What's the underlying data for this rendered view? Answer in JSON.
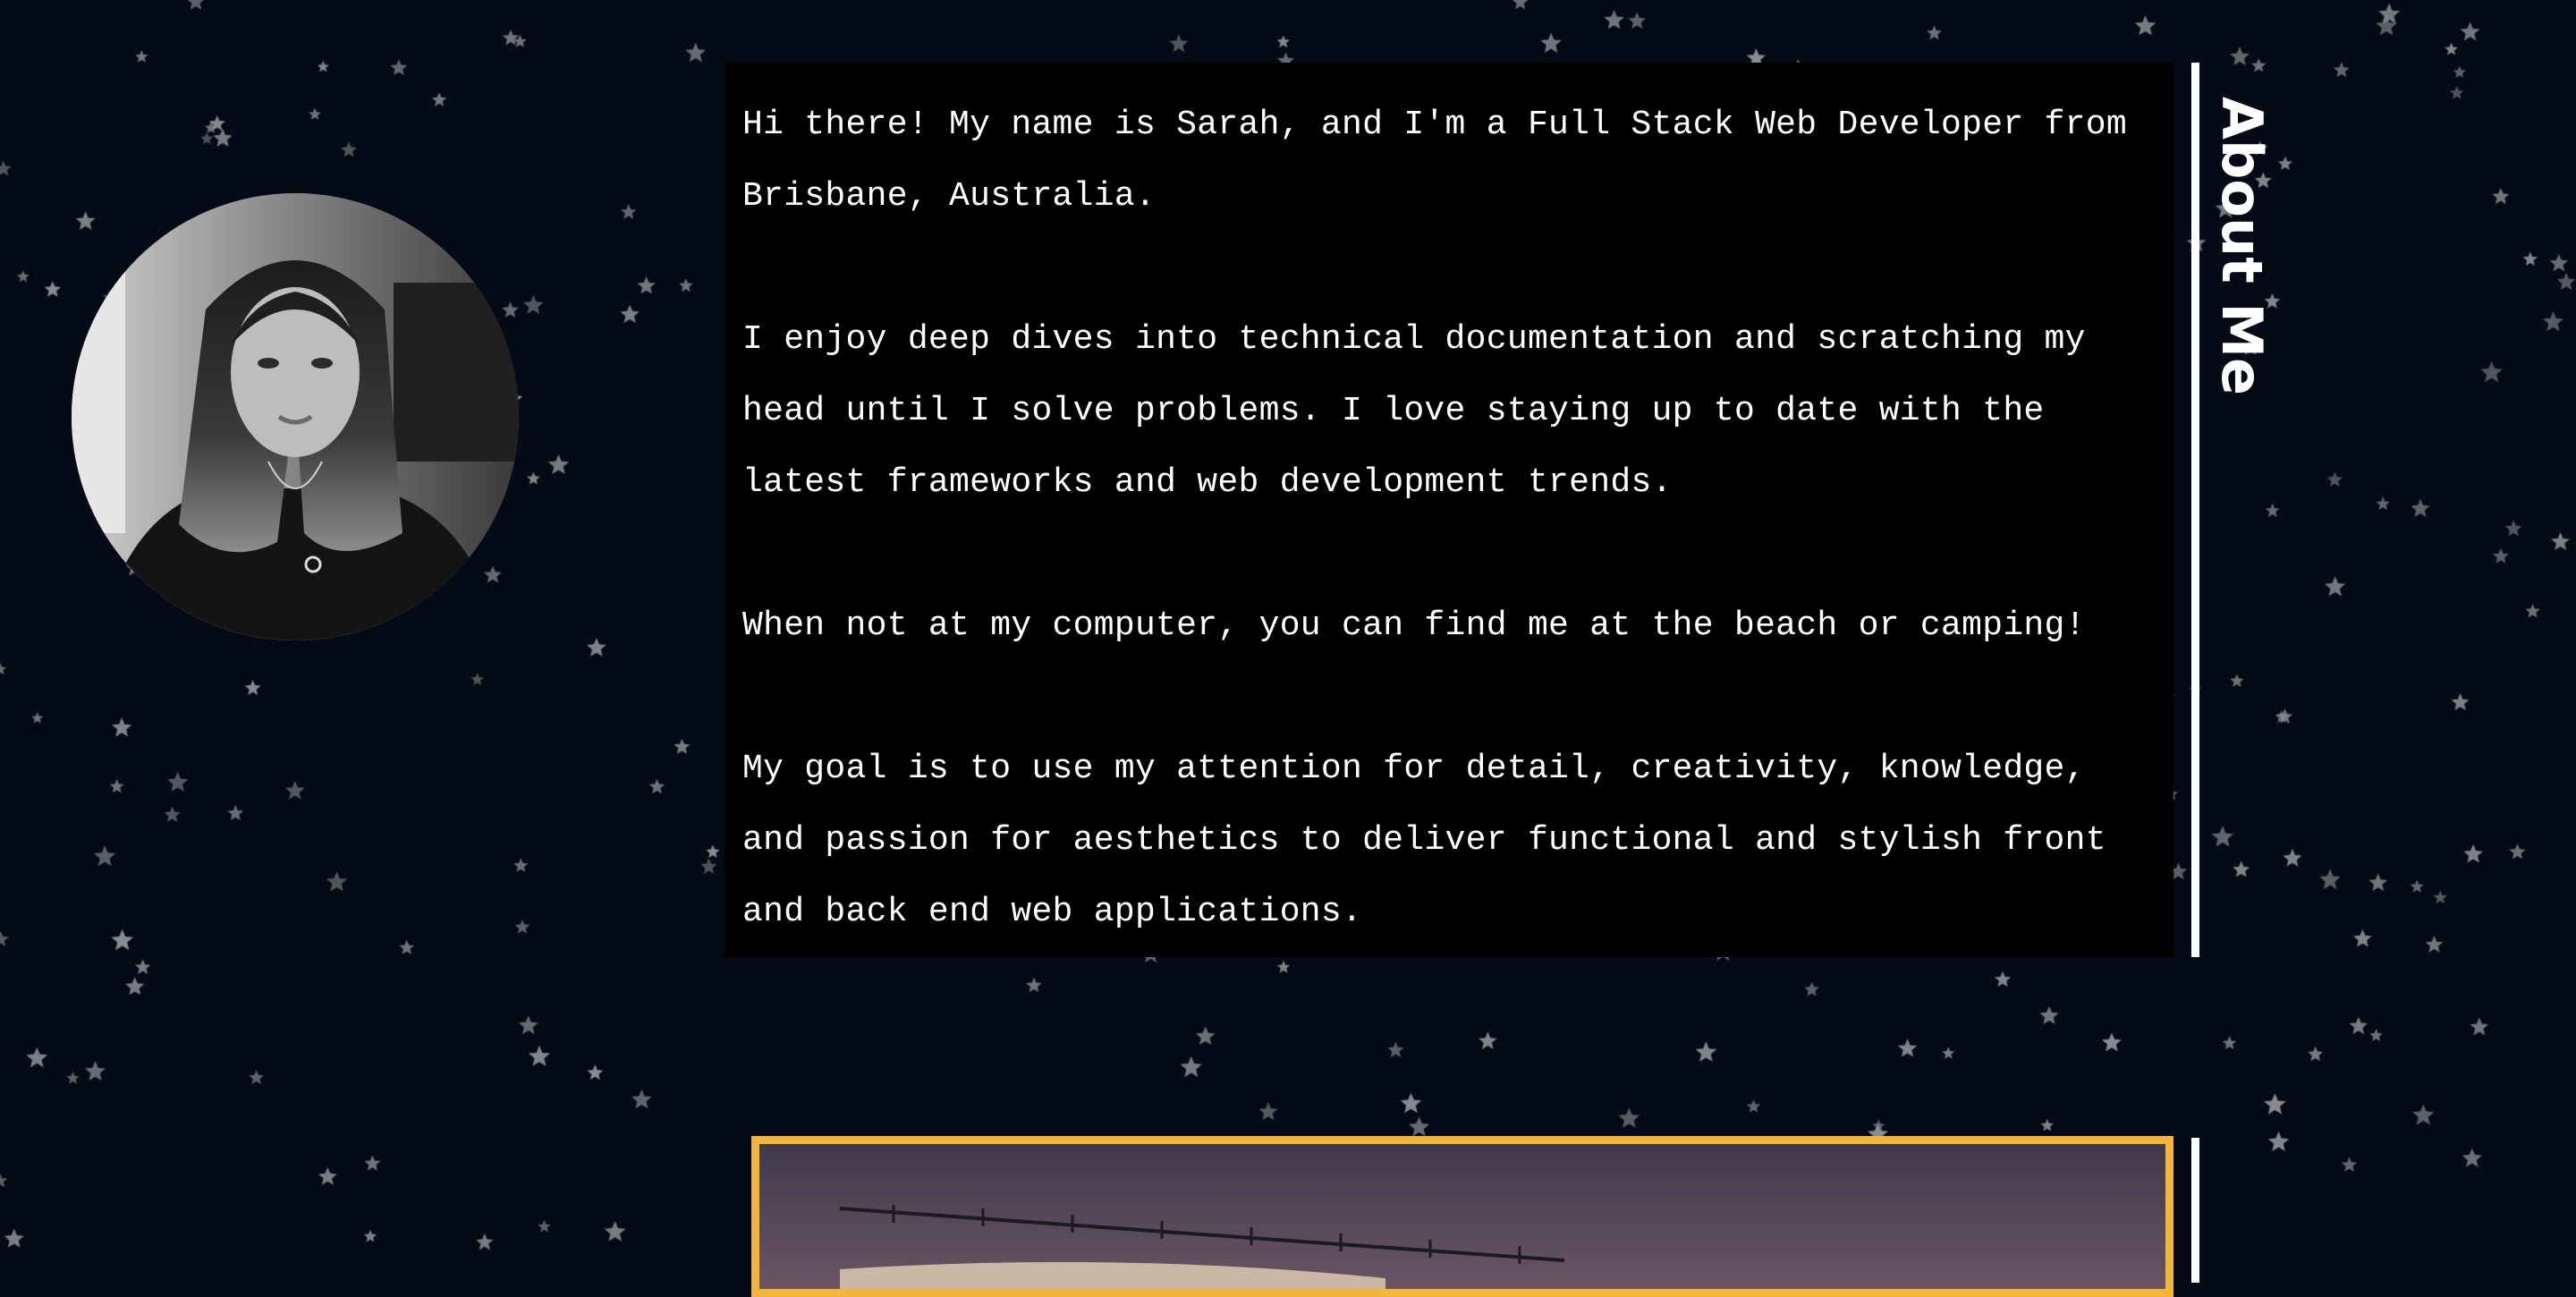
{
  "about": {
    "section_title": "About Me",
    "paragraphs": [
      "Hi there! My name is Sarah, and I'm a Full Stack Web Developer from Brisbane, Australia.",
      "I enjoy deep dives into technical documentation and scratching my head until I solve problems. I love staying up to date with the latest frameworks and web development trends.",
      "When not at my computer, you can find me at the beach or camping!",
      "My goal is to use my attention for detail, creativity, knowledge, and passion for aesthetics to deliver functional and stylish front and back end web applications."
    ]
  },
  "images": {
    "profile_photo": "profile-photo",
    "project_preview": "project-preview"
  },
  "colors": {
    "background": "#050a17",
    "text_panel": "#000000",
    "text": "#ffffff",
    "accent_border": "#f2b63c",
    "star": "#8a8c92"
  }
}
